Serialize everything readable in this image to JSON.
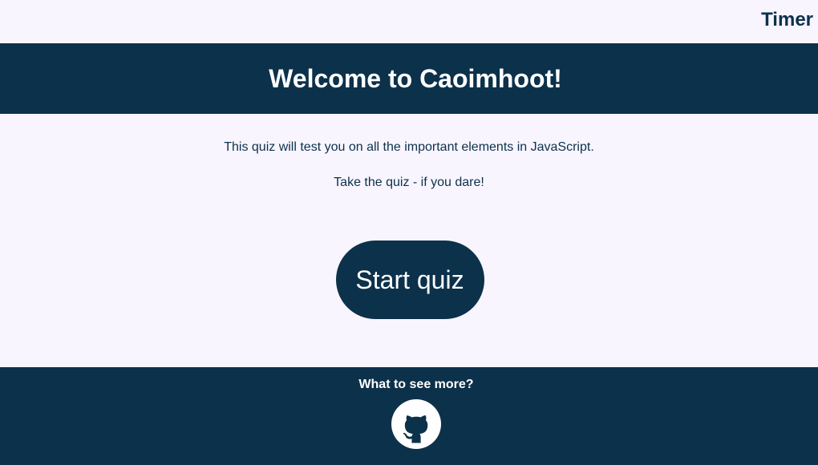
{
  "timer": {
    "label": "Timer"
  },
  "header": {
    "title": "Welcome to Caoimhoot!"
  },
  "intro": {
    "line1": "This quiz will test you on all the important elements in JavaScript.",
    "line2": "Take the quiz - if you dare!"
  },
  "start": {
    "label": "Start quiz"
  },
  "footer": {
    "prompt": "What to see more?",
    "link_icon": "github-icon"
  },
  "colors": {
    "primary": "#0c314b",
    "background": "#f8f5fe",
    "text_on_primary": "#ffffff"
  }
}
